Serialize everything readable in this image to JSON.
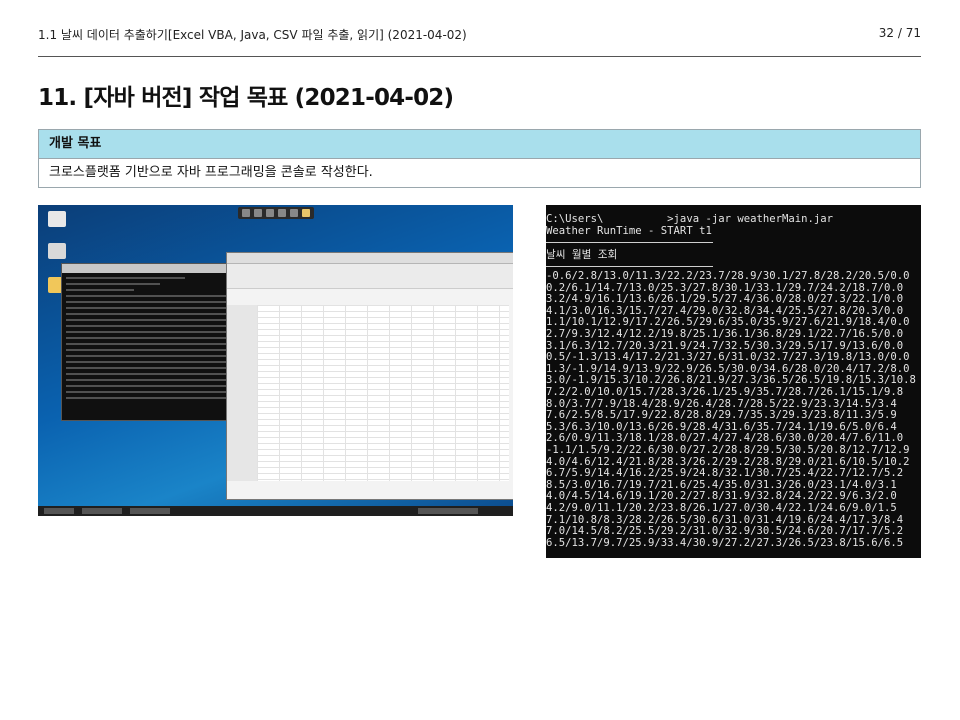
{
  "header": {
    "title": "1.1 날씨 데이터 추출하기[Excel VBA, Java, CSV 파일 추출, 읽기] (2021-04-02)",
    "page_number": "32 / 71"
  },
  "page_title": "11. [자바 버전] 작업 목표 (2021-04-02)",
  "goal": {
    "heading": "개발 목표",
    "text": "크로스플랫폼 기반으로 자바 프로그래밍을 콘솔로 작성한다."
  },
  "console": {
    "prompt": "C:\\Users\\          >java -jar weatherMain.jar",
    "runtime": "Weather RunTime - START t1",
    "heading": "날씨 월별 조회",
    "rows": [
      "-0.6/2.8/13.0/11.3/22.2/23.7/28.9/30.1/27.8/28.2/20.5/0.0",
      "0.2/6.1/14.7/13.0/25.3/27.8/30.1/33.1/29.7/24.2/18.7/0.0",
      "3.2/4.9/16.1/13.6/26.1/29.5/27.4/36.0/28.0/27.3/22.1/0.0",
      "4.1/3.0/16.3/15.7/27.4/29.0/32.8/34.4/25.5/27.8/20.3/0.0",
      "1.1/10.1/12.9/17.2/26.5/29.6/35.0/35.9/27.6/21.9/18.4/0.0",
      "2.7/9.3/12.4/12.2/19.8/25.1/36.1/36.8/29.1/22.7/16.5/0.0",
      "3.1/6.3/12.7/20.3/21.9/24.7/32.5/30.3/29.5/17.9/13.6/0.0",
      "0.5/-1.3/13.4/17.2/21.3/27.6/31.0/32.7/27.3/19.8/13.0/0.0",
      "1.3/-1.9/14.9/13.9/22.9/26.5/30.0/34.6/28.0/20.4/17.2/8.0",
      "3.0/-1.9/15.3/10.2/26.8/21.9/27.3/36.5/26.5/19.8/15.3/10.8",
      "7.2/2.0/10.0/15.7/28.3/26.1/25.9/35.7/28.7/26.1/15.1/9.8",
      "8.0/3.7/7.9/18.4/28.9/26.4/28.7/28.5/22.9/23.3/14.5/3.4",
      "7.6/2.5/8.5/17.9/22.8/28.8/29.7/35.3/29.3/23.8/11.3/5.9",
      "5.3/6.3/10.0/13.6/26.9/28.4/31.6/35.7/24.1/19.6/5.0/6.4",
      "2.6/0.9/11.3/18.1/28.0/27.4/27.4/28.6/30.0/20.4/7.6/11.0",
      "-1.1/1.5/9.2/22.6/30.0/27.2/28.8/29.5/30.5/20.8/12.7/12.9",
      "4.0/4.6/12.4/21.8/28.3/26.2/29.2/28.8/29.0/21.6/10.5/10.2",
      "6.7/5.9/14.4/16.2/25.9/24.8/32.1/30.7/25.4/22.7/12.7/5.2",
      "8.5/3.0/16.7/19.7/21.6/25.4/35.0/31.3/26.0/23.1/4.0/3.1",
      "4.0/4.5/14.6/19.1/20.2/27.8/31.9/32.8/24.2/22.9/6.3/2.0",
      "4.2/9.0/11.1/20.2/23.8/26.1/27.0/30.4/22.1/24.6/9.0/1.5",
      "7.1/10.8/8.3/28.2/26.5/30.6/31.0/31.4/19.6/24.4/17.3/8.4",
      "7.0/14.5/8.2/25.5/29.2/31.0/32.9/30.5/24.6/20.7/17.7/5.2",
      "6.5/13.7/9.7/25.9/33.4/30.9/27.2/27.3/26.5/23.8/15.6/6.5"
    ]
  },
  "colors": {
    "goal_header_bg": "#a9dfec",
    "console_bg": "#0c0c0c",
    "console_text": "#e4e4e4",
    "desktop_bg": "#0a62b0"
  }
}
